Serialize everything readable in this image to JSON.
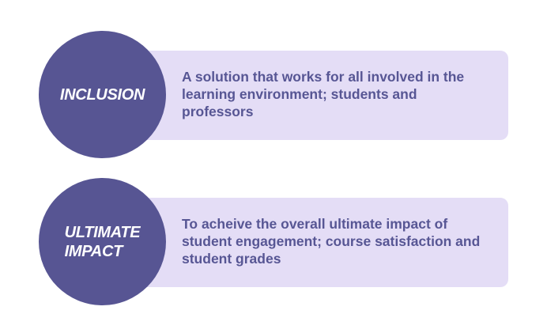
{
  "items": [
    {
      "title": "INCLUSION",
      "description": "A solution that works for all involved in the learning environment; students and professors"
    },
    {
      "title": "ULTIMATE\nIMPACT",
      "description": "To acheive the overall ultimate impact of student engagement; course satisfaction and student grades"
    }
  ],
  "colors": {
    "circle": "#575593",
    "card": "#e4ddf6",
    "text": "#575694"
  }
}
